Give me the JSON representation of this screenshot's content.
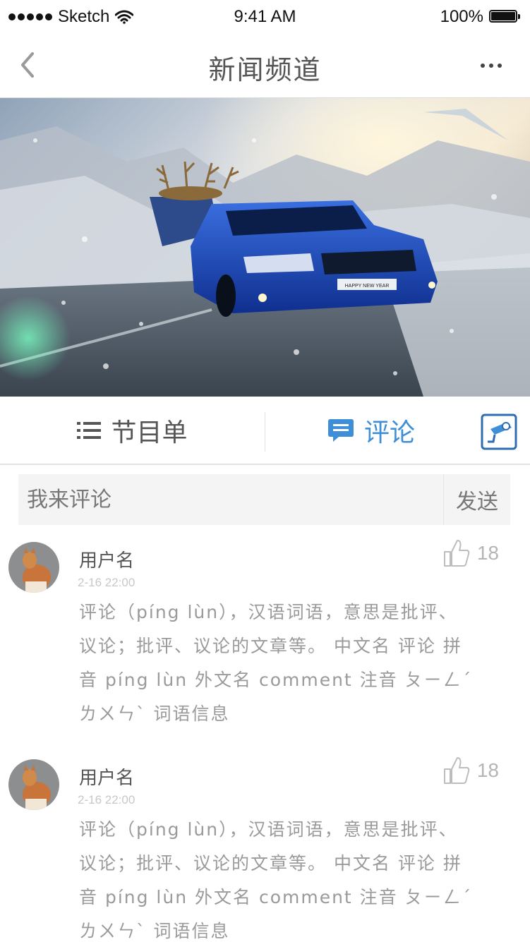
{
  "status_bar": {
    "carrier": "Sketch",
    "time": "9:41 AM",
    "battery": "100%"
  },
  "nav": {
    "title": "新闻频道",
    "back_icon": "chevron-left-icon",
    "more_icon": "more-icon"
  },
  "hero": {
    "plate_text": "HAPPY NEW YEAR"
  },
  "tabs": [
    {
      "label": "节目单",
      "icon": "list-icon",
      "active": false
    },
    {
      "label": "评论",
      "icon": "comment-bubble-icon",
      "active": true
    }
  ],
  "camera_icon": "camera-icon",
  "comment_form": {
    "placeholder": "我来评论",
    "send_label": "发送"
  },
  "comments": [
    {
      "username": "用户名",
      "time": "2-16 22:00",
      "likes": "18",
      "text": "评论（píng lùn），汉语词语，意思是批评、议论；批评、议论的文章等。 中文名 评论 拼音 píng lùn 外文名 comment 注音 ㄆㄧㄥˊ ㄌㄨㄣˋ 词语信息"
    },
    {
      "username": "用户名",
      "time": "2-16 22:00",
      "likes": "18",
      "text": "评论（píng lùn），汉语词语，意思是批评、议论；批评、议论的文章等。 中文名 评论 拼音 píng lùn 外文名 comment 注音 ㄆㄧㄥˊ ㄌㄨㄣˋ 词语信息"
    }
  ],
  "colors": {
    "accent": "#3f8fd8",
    "text": "#555555",
    "muted": "#9a9a9a"
  }
}
